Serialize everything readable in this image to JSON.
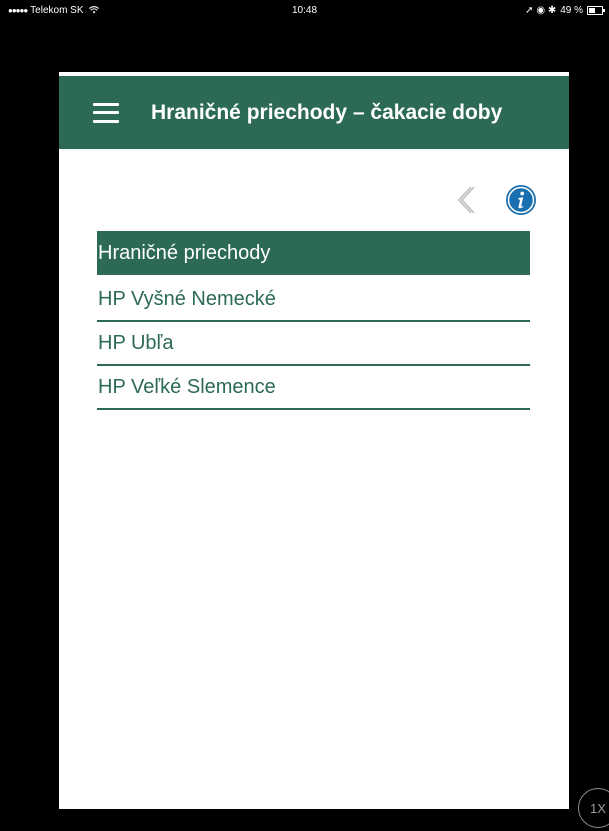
{
  "status_bar": {
    "signal_dots": "●●●●●",
    "carrier": "Telekom SK",
    "wifi_icon": "wifi-icon",
    "time": "10:48",
    "right_icons": "➚ ◉ ✱",
    "battery_text": "49 %"
  },
  "app_bar": {
    "menu_icon": "hamburger-menu-icon",
    "title": "Hraničné priechody – čakacie doby"
  },
  "toolbar": {
    "back_icon": "chevron-left-icon",
    "info_icon": "info-icon"
  },
  "list": {
    "header": "Hraničné priechody",
    "items": [
      {
        "label": "HP Vyšné Nemecké"
      },
      {
        "label": "HP Ubľa"
      },
      {
        "label": "HP Veľké Slemence"
      }
    ]
  },
  "zoom_badge": "1X",
  "colors": {
    "primary": "#2c6a56",
    "info_blue": "#1a6fb0",
    "background": "#000000"
  }
}
